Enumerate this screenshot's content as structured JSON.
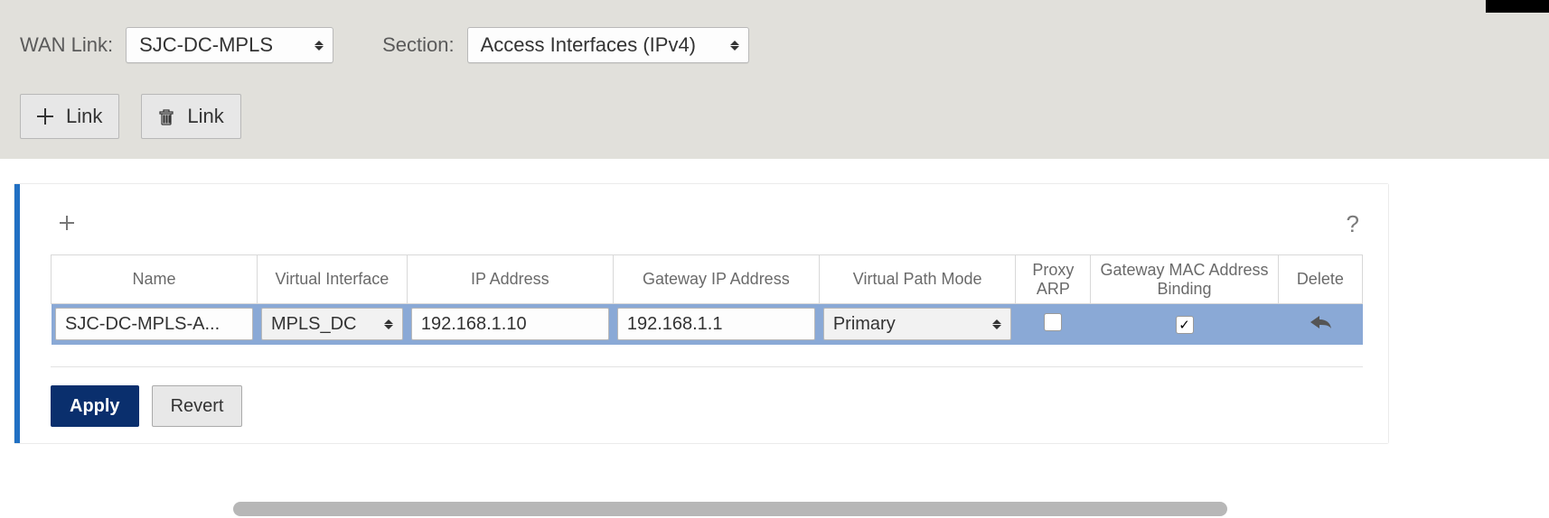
{
  "filters": {
    "wan_link_label": "WAN Link:",
    "wan_link_value": "SJC-DC-MPLS",
    "section_label": "Section:",
    "section_value": "Access Interfaces (IPv4)"
  },
  "toolbar": {
    "add_link_label": "Link",
    "delete_link_label": "Link"
  },
  "table": {
    "headers": {
      "name": "Name",
      "virtual_interface": "Virtual Interface",
      "ip_address": "IP Address",
      "gateway_ip": "Gateway IP Address",
      "virtual_path_mode": "Virtual Path Mode",
      "proxy_arp": "Proxy ARP",
      "gateway_mac_binding": "Gateway MAC Address Binding",
      "delete": "Delete"
    },
    "rows": [
      {
        "name": "SJC-DC-MPLS-A...",
        "virtual_interface": "MPLS_DC",
        "ip_address": "192.168.1.10",
        "gateway_ip": "192.168.1.1",
        "virtual_path_mode": "Primary",
        "proxy_arp": false,
        "gateway_mac_binding": true
      }
    ]
  },
  "footer": {
    "apply_label": "Apply",
    "revert_label": "Revert"
  }
}
